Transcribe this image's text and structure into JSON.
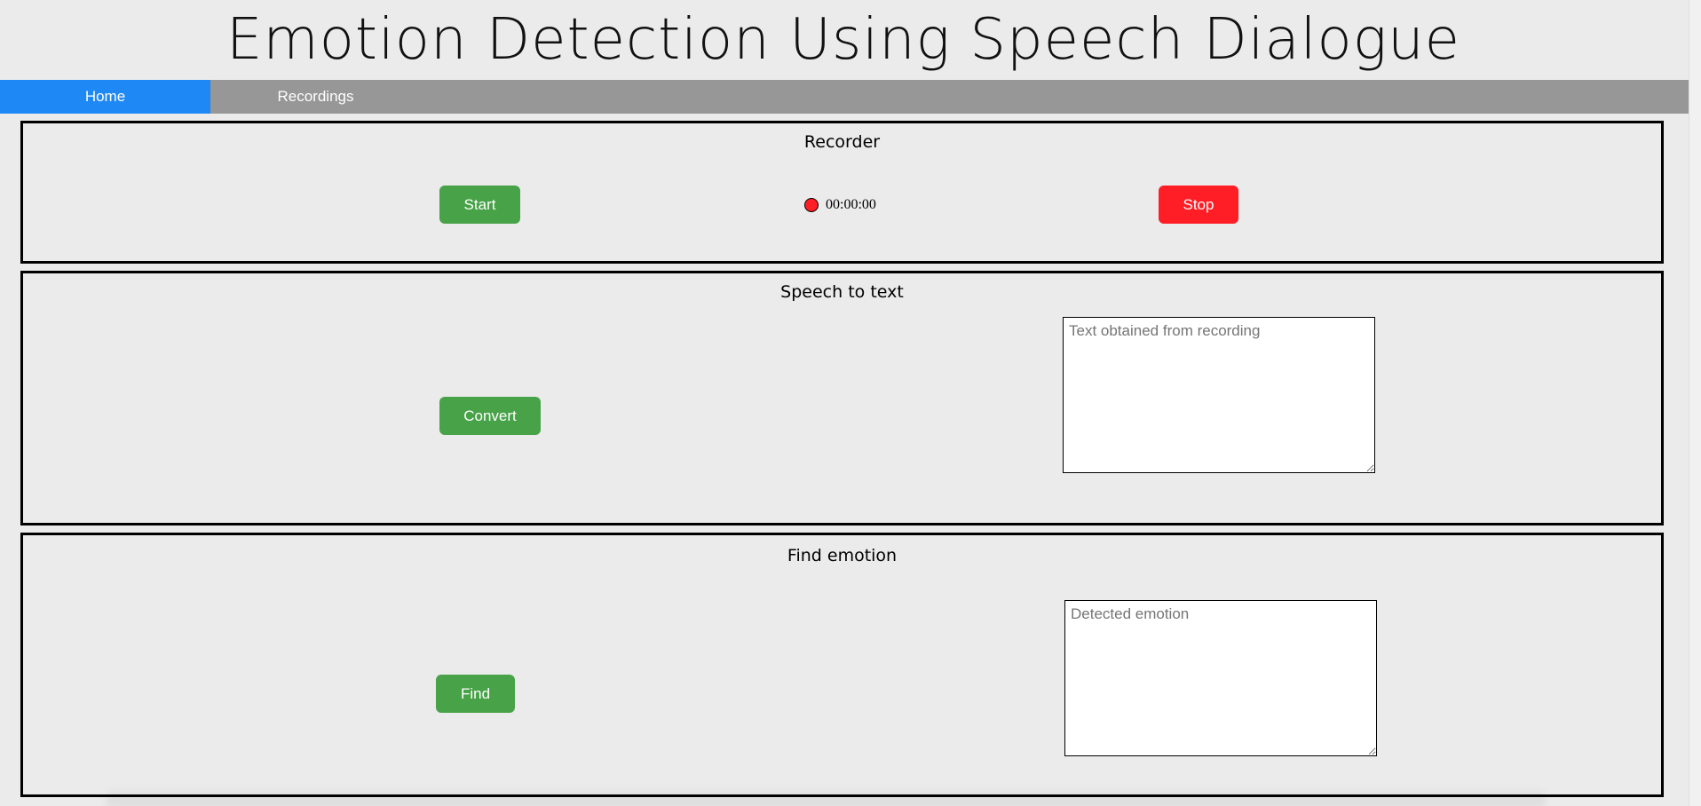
{
  "header": {
    "title": "Emotion Detection Using Speech Dialogue"
  },
  "nav": {
    "items": [
      {
        "label": "Home",
        "active": true
      },
      {
        "label": "Recordings",
        "active": false
      }
    ],
    "active_color": "#1e88f5",
    "bar_color": "#979797"
  },
  "recorder": {
    "heading": "Recorder",
    "start_label": "Start",
    "stop_label": "Stop",
    "timer": "00:00:00",
    "indicator_icon": "record-dot-icon"
  },
  "speech_to_text": {
    "heading": "Speech to text",
    "convert_label": "Convert",
    "output_value": "",
    "output_placeholder": "Text obtained from recording"
  },
  "find_emotion": {
    "heading": "Find emotion",
    "find_label": "Find",
    "output_value": "",
    "output_placeholder": "Detected emotion"
  },
  "colors": {
    "green_button": "#47a248",
    "red_button": "#ff1e26",
    "background": "#ebebeb"
  }
}
